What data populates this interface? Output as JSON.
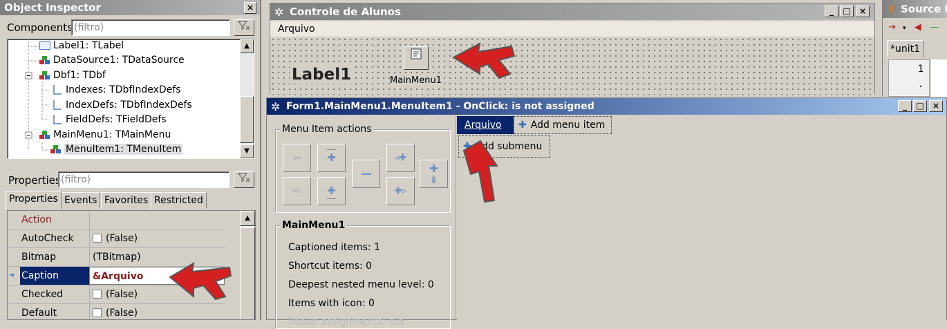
{
  "object_inspector": {
    "title": "Object Inspector",
    "components_label": "Components",
    "filter_placeholder": "(filtro)",
    "tree": [
      {
        "label": "Label1: TLabel",
        "icon": "label-icon"
      },
      {
        "label": "DataSource1: TDataSource",
        "icon": "component-icon"
      },
      {
        "label": "Dbf1: TDbf",
        "icon": "component-icon"
      },
      {
        "label": "Indexes: TDbfIndexDefs",
        "icon": "collection-icon"
      },
      {
        "label": "IndexDefs: TDbfIndexDefs",
        "icon": "collection-icon"
      },
      {
        "label": "FieldDefs: TFieldDefs",
        "icon": "collection-icon"
      },
      {
        "label": "MainMenu1: TMainMenu",
        "icon": "component-icon"
      },
      {
        "label": "MenuItem1: TMenuItem",
        "icon": "component-icon",
        "selected": true
      }
    ],
    "properties_label": "Properties",
    "tabs": [
      "Properties",
      "Events",
      "Favorites",
      "Restricted"
    ],
    "properties": [
      {
        "name": "Action",
        "value": ""
      },
      {
        "name": "AutoCheck",
        "value": "(False)",
        "checkbox": true
      },
      {
        "name": "Bitmap",
        "value": "(TBitmap)"
      },
      {
        "name": "Caption",
        "value": "&Arquivo",
        "selected": true
      },
      {
        "name": "Checked",
        "value": "(False)",
        "checkbox": true
      },
      {
        "name": "Default",
        "value": "(False)",
        "checkbox": true
      }
    ]
  },
  "form_window": {
    "title": "Controle de Alunos",
    "menu_bar_item": "Arquivo",
    "label_text": "Label1",
    "component_caption": "MainMenu1"
  },
  "source_editor": {
    "title": "Source E",
    "tab": "*unit1",
    "line_number": "1",
    "line_dot": "·"
  },
  "menu_editor": {
    "title": "Form1.MainMenu1.MenuItem1 - OnClick: is not assigned",
    "actions_group": "Menu Item actions",
    "menu_item_caption": "Arquivo",
    "add_menu_item": "Add menu item",
    "add_submenu": "Add submenu",
    "stats_group": "MainMenu1",
    "stats": [
      "Captioned items: 1",
      "Shortcut items: 0",
      "Deepest nested menu level: 0",
      "Items with icon: 0",
      "Popup assignments: n/a"
    ]
  },
  "window_controls": {
    "minimize": "_",
    "maximize": "□",
    "close": "×"
  },
  "colors": {
    "selection": "#0a246a",
    "arrow": "#d42020",
    "caption_value": "#8b1a1a"
  }
}
